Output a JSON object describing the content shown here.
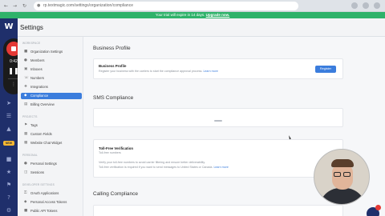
{
  "browser": {
    "url": "rp.textmagic.com/settings/organization/compliance"
  },
  "banner": {
    "text": "Your trial will expire in 14 days.",
    "link": "Upgrade now."
  },
  "recorder": {
    "time": "0:42"
  },
  "header": {
    "title": "Settings"
  },
  "sidebar": {
    "sections": [
      {
        "label": "WORKSPACE",
        "items": [
          {
            "label": "Organization Settings",
            "icon": "building-icon"
          },
          {
            "label": "Members",
            "icon": "users-icon"
          },
          {
            "label": "Inboxes",
            "icon": "inbox-icon"
          },
          {
            "label": "Numbers",
            "icon": "phone-icon"
          },
          {
            "label": "Integrations",
            "icon": "puzzle-icon"
          },
          {
            "label": "Compliance",
            "icon": "shield-icon",
            "active": true
          },
          {
            "label": "Billing Overview",
            "icon": "receipt-icon"
          }
        ]
      },
      {
        "label": "PROJECTS",
        "items": [
          {
            "label": "Tags",
            "icon": "tag-icon"
          },
          {
            "label": "Custom Fields",
            "icon": "fields-icon"
          },
          {
            "label": "Website Chat Widget",
            "icon": "chat-icon"
          }
        ]
      },
      {
        "label": "PERSONAL",
        "items": [
          {
            "label": "Personal Settings",
            "icon": "person-icon"
          },
          {
            "label": "Sessions",
            "icon": "session-icon"
          }
        ]
      },
      {
        "label": "DEVELOPER SETTINGS",
        "items": [
          {
            "label": "OAuth Applications",
            "icon": "key-icon"
          },
          {
            "label": "Personal Access Tokens",
            "icon": "token-icon"
          },
          {
            "label": "Public API Tokens",
            "icon": "api-icon"
          }
        ]
      }
    ]
  },
  "main": {
    "business_profile": {
      "heading": "Business Profile",
      "card_title": "Business Profile",
      "card_text": "Register your business with the carriers to start the compliance approval process.",
      "card_link": "Learn more",
      "button": "Register"
    },
    "sms_compliance": {
      "heading": "SMS Compliance",
      "tollfree_title": "Toll-Free Verification",
      "tollfree_subtitle": "Toll-free numbers",
      "tollfree_text_1": "Verify your toll-free numbers to avoid carrier filtering and ensure better deliverability.",
      "tollfree_text_2": "Toll-free verification is required if you want to send messages to United States or Canada.",
      "tollfree_link": "Learn more"
    },
    "calling_compliance": {
      "heading": "Calling Compliance"
    }
  },
  "colors": {
    "accent": "#3b7ddd",
    "banner": "#2fb26a",
    "rail": "#1f2f6b",
    "record": "#e53935"
  }
}
